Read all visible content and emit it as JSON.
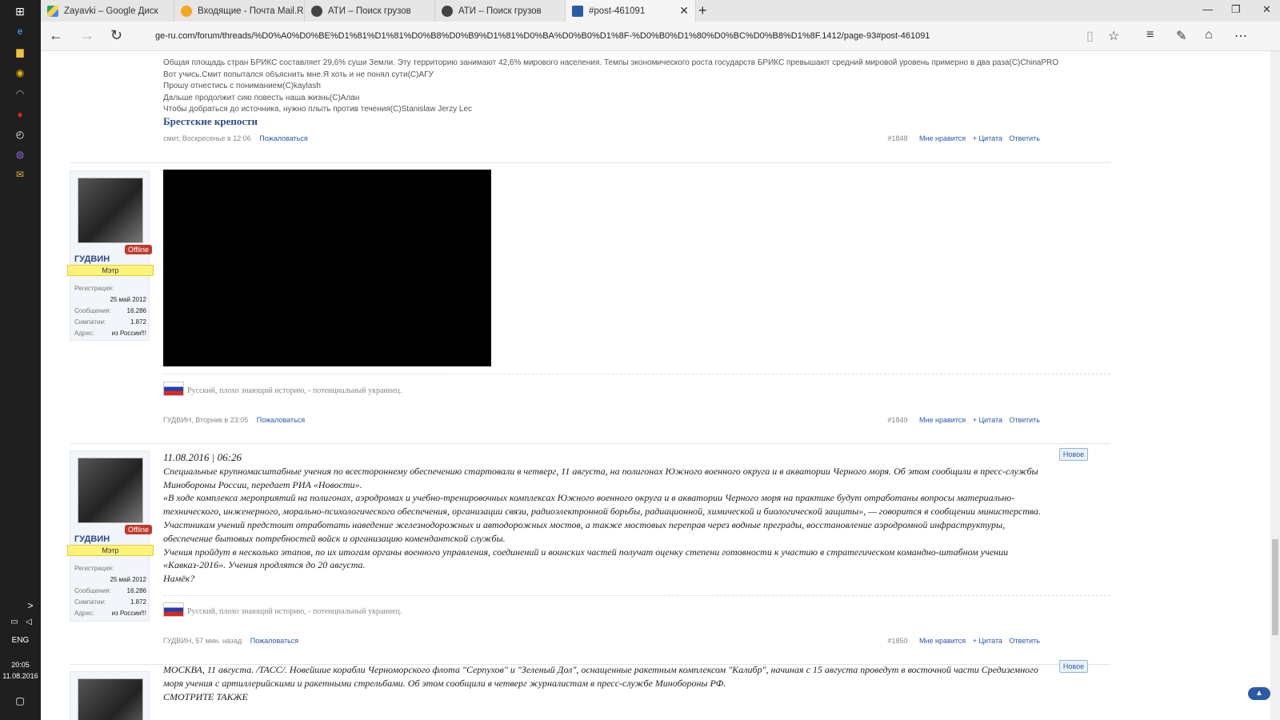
{
  "taskbar": {
    "lang": "ENG",
    "time": "20:05",
    "date": "11.08.2016",
    "expand_label": ">"
  },
  "tabs": [
    {
      "label": "Zayavki – Google Диск"
    },
    {
      "label": "Входящие - Почта Mail.Ru"
    },
    {
      "label": "АТИ – Поиск грузов"
    },
    {
      "label": "АТИ – Поиск грузов"
    },
    {
      "label": "#post-461091"
    }
  ],
  "address": {
    "url": "ge-ru.com/forum/threads/%D0%A0%D0%BE%D1%81%D1%81%D0%B8%D0%B9%D1%81%D0%BA%D0%B0%D1%8F-%D0%B0%D1%80%D0%BC%D0%B8%D1%8F.1412/page-93#post-461091"
  },
  "post1848": {
    "quotes": [
      "Общая площадь стран БРИКС составляет 29,6% суши Земли. Эту территорию занимают 42,6% мирового населения. Темпы экономического роста государств БРИКС превышают средний мировой уровень примерно в два раза(C)ChinaPRO",
      "Вот учись.Смит попытался объяснить мне.Я хоть и не понял сути(С)АГУ",
      "Прошу отнестись с пониманием(С)kaylash",
      "Дальше продолжит сию повесть наша жизнь(С)Алан",
      "Чтобы добраться до источника, нужно плыть против течения(C)Stanislaw Jerzy Lec"
    ],
    "link_title": "Брестские крепости",
    "meta": "смит, Воскресенье в 12:06",
    "report": "Пожаловаться",
    "num": "#1848",
    "like": "Мне нравится",
    "quote": "+ Цитата",
    "reply": "Ответить"
  },
  "user": {
    "name": "ГУДВИН",
    "offline": "Offline",
    "rank": "Мэтр",
    "reg_label": "Регистрация:",
    "reg_value": "25 май 2012",
    "msg_label": "Сообщения:",
    "msg_value": "16.286",
    "likes_label": "Симпатии:",
    "likes_value": "1.872",
    "addr_label": "Адрес:",
    "addr_value": "из России!!!"
  },
  "post1849": {
    "signature": "Русский, плохо знающий историю, - потенциальный украинец.",
    "meta": "ГУДВИН, Вторник в 23:05",
    "report": "Пожаловаться",
    "num": "#1849",
    "like": "Мне нравится",
    "quote": "+ Цитата",
    "reply": "Ответить"
  },
  "post1850": {
    "new_badge": "Новое",
    "date": "11.08.2016 | 06:26",
    "p1": "Специальные крупномасштабные учения по всестороннему обеспечению стартовали в четверг, 11 августа, на полигонах Южного военного округа и в акватории Черного моря. Об этом сообщили в пресс-службы Минобороны России, передает РИА «Новости».",
    "p2": "«В ходе комплекса мероприятий на полигонах, аэродромах и учебно-тренировочных комплексах Южного военного округа и в акватории Черного моря на практике будут отработаны вопросы материально-технического, инженерного, морально-психологического обеспечения, организации связи, радиоэлектронной борьбы, радиационной, химической и биологической защиты», — говорится в сообщении министерства.",
    "p3": "Участникам учений предстоит отработать наведение железнодорожных и автодорожных мостов, а также мостовых переправ через водные преграды, восстановление аэродромной инфраструктуры, обеспечение бытовых потребностей войск и организацию комендантской службы.",
    "p4": "Учения пройдут в несколько этапов, по их итогам органы военного управления, соединений и воинских частей получат оценку степени готовности к участию в стратегическом командно-штабном учении «Кавказ-2016». Учения продлятся до 20 августа.",
    "p5": "Намёк?",
    "signature": "Русский, плохо знающий историю, - потенциальный украинец.",
    "meta": "ГУДВИН, 57 мин. назад",
    "report": "Пожаловаться",
    "num": "#1850",
    "like": "Мне нравится",
    "quote": "+ Цитата",
    "reply": "Ответить"
  },
  "post1851": {
    "new_badge": "Новое",
    "p1": "МОСКВА, 11 августа. /ТАСС/. Новейшие корабли Черноморского флота \"Серпухов\" и \"Зеленый Дол\", оснащенные ракетным комплексом \"Калибр\", начиная с 15 августа проведут в восточной части Средиземного моря учения с артиллерийскими и ракетными стрельбами. Об этом сообщили в четверг журналистам в пресс-службе Минобороны РФ.",
    "p2": "СМОТРИТЕ ТАКЖЕ"
  }
}
